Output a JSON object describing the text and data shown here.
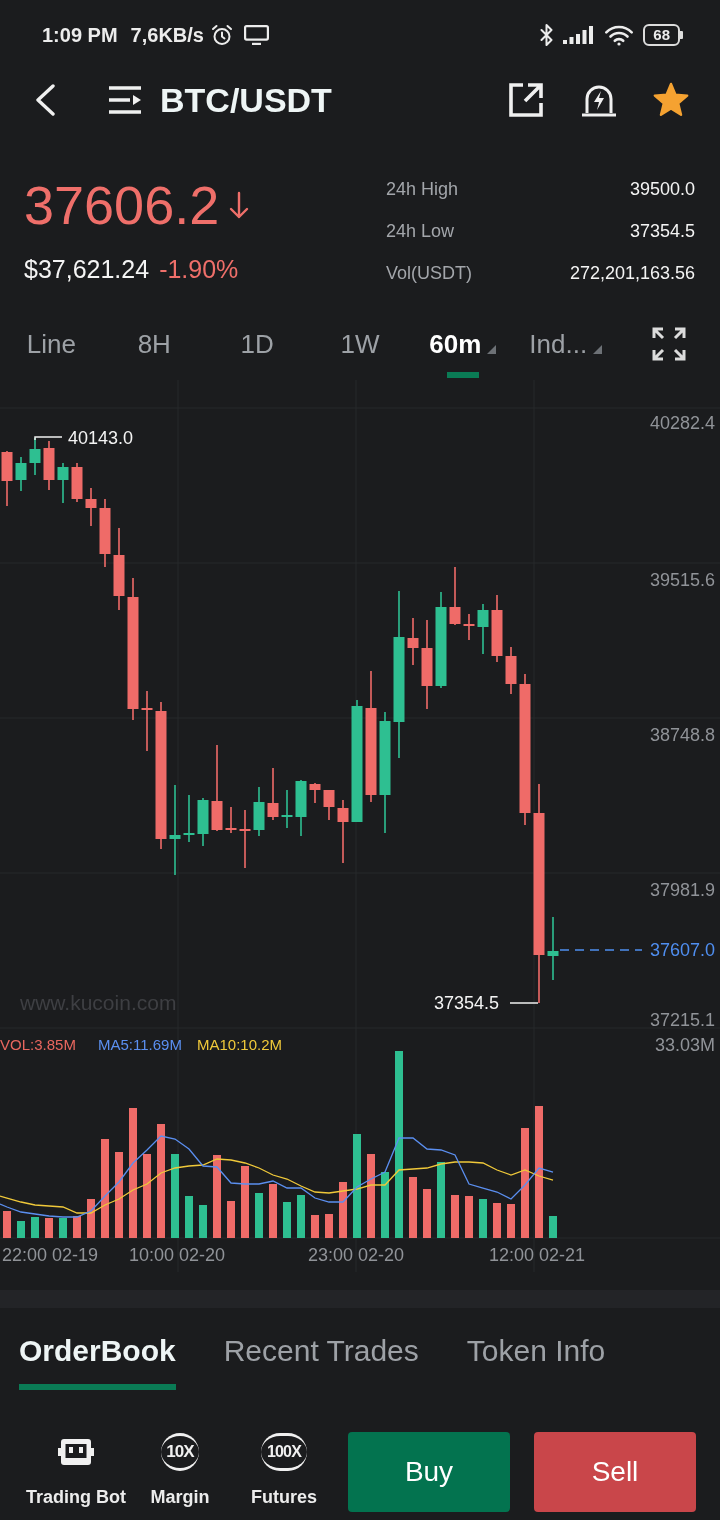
{
  "status_bar": {
    "time": "1:09 PM",
    "network_speed": "7,6KB/s",
    "battery": "68"
  },
  "header": {
    "title": "BTC/USDT",
    "favorite": true
  },
  "ticker": {
    "price": "37606.2",
    "falling": true,
    "usd_price": "$37,621.24",
    "change": "-1.90%",
    "stats": [
      {
        "label": "24h High",
        "value": "39500.0"
      },
      {
        "label": "24h Low",
        "value": "37354.5"
      },
      {
        "label": "Vol(USDT)",
        "value": "272,201,163.56"
      }
    ]
  },
  "intervals": [
    {
      "label": "Line",
      "selected": false,
      "dropdown": false
    },
    {
      "label": "8H",
      "selected": false,
      "dropdown": false
    },
    {
      "label": "1D",
      "selected": false,
      "dropdown": false
    },
    {
      "label": "1W",
      "selected": false,
      "dropdown": false
    },
    {
      "label": "60m",
      "selected": true,
      "dropdown": true
    },
    {
      "label": "Ind...",
      "selected": false,
      "dropdown": true
    }
  ],
  "chart": {
    "price_axis": [
      "40282.4",
      "39515.6",
      "38748.8",
      "37981.9",
      "37215.1"
    ],
    "high_label": "40143.0",
    "low_label": "37354.5",
    "last_price": "37607.0",
    "watermark": "www.kucoin.com",
    "volume_legend": [
      {
        "label": "VOL:3.85M",
        "color": "#e9675f"
      },
      {
        "label": "MA5:11.69M",
        "color": "#5b8ff0"
      },
      {
        "label": "MA10:10.2M",
        "color": "#f0c93a"
      }
    ],
    "volume_max": "33.03M",
    "time_axis": [
      "22:00 02-19",
      "10:00 02-20",
      "23:00 02-20",
      "12:00 02-21"
    ]
  },
  "panel_tabs": [
    {
      "label": "OrderBook",
      "selected": true
    },
    {
      "label": "Recent Trades",
      "selected": false
    },
    {
      "label": "Token Info",
      "selected": false
    }
  ],
  "shortcuts": [
    {
      "kind": "bot",
      "label": "Trading Bot"
    },
    {
      "kind": "leverage",
      "badge": "10X",
      "label": "Margin"
    },
    {
      "kind": "leverage",
      "badge": "100X",
      "label": "Futures"
    }
  ],
  "actions": [
    {
      "kind": "buy",
      "label": "Buy"
    },
    {
      "kind": "sell",
      "label": "Sell"
    }
  ]
}
